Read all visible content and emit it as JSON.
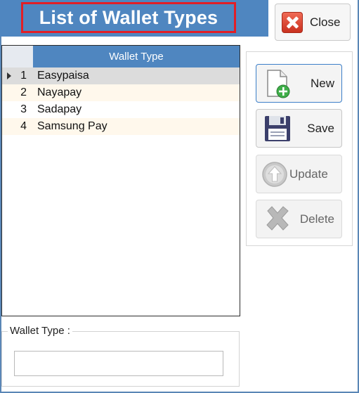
{
  "window": {
    "title": "List of Wallet Types",
    "close_label": "Close"
  },
  "grid": {
    "column_header": "Wallet Type",
    "rows": [
      {
        "index": "1",
        "value": "Easypaisa",
        "selected": true
      },
      {
        "index": "2",
        "value": "Nayapay",
        "selected": false
      },
      {
        "index": "3",
        "value": "Sadapay",
        "selected": false
      },
      {
        "index": "4",
        "value": "Samsung Pay",
        "selected": false
      }
    ]
  },
  "actions": {
    "new_label": "New",
    "save_label": "Save",
    "update_label": "Update",
    "delete_label": "Delete"
  },
  "form": {
    "wallet_type_label": "Wallet Type :",
    "wallet_type_value": ""
  },
  "colors": {
    "title_bar": "#4f86c0",
    "title_highlight": "#e21e26",
    "grid_header": "#4f86c0",
    "alt_row": "#fff8ec",
    "selected_row": "#dcdcdc"
  },
  "icons": {
    "close": "close-icon",
    "new": "new-document-icon",
    "save": "floppy-disk-icon",
    "update": "up-arrow-icon",
    "delete": "delete-x-icon",
    "row_pointer": "row-pointer-icon"
  }
}
